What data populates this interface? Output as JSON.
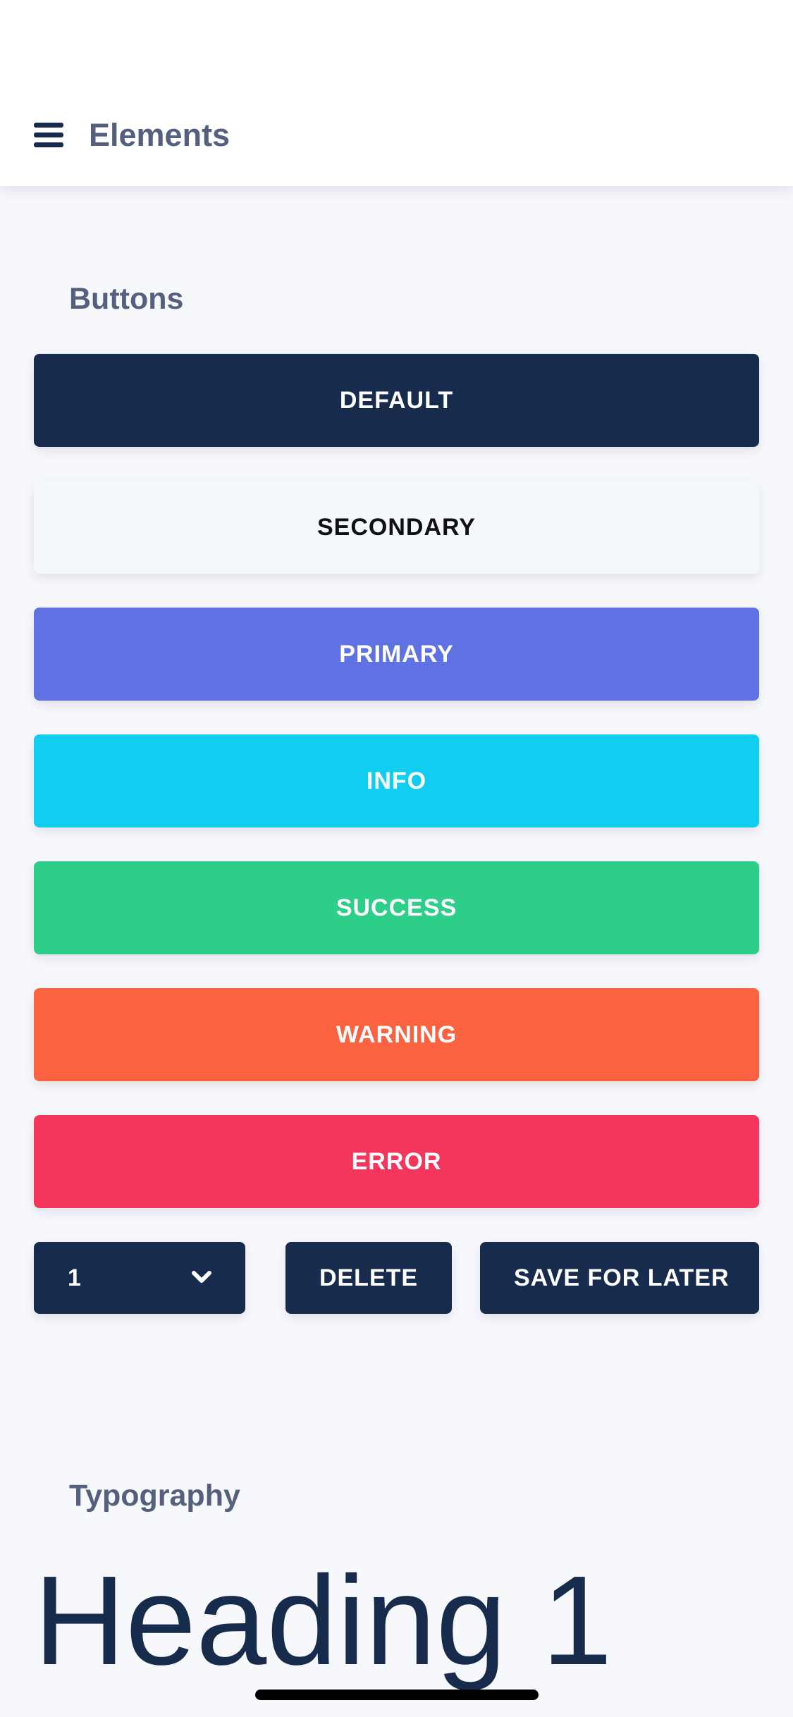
{
  "header": {
    "title": "Elements",
    "menu_icon": "hamburger-menu-icon"
  },
  "sections": {
    "buttons_title": "Buttons",
    "typography_title": "Typography"
  },
  "buttons": {
    "default": "DEFAULT",
    "secondary": "SECONDARY",
    "primary": "PRIMARY",
    "info": "INFO",
    "success": "SUCCESS",
    "warning": "WARNING",
    "error": "ERROR"
  },
  "controls": {
    "select_value": "1",
    "select_icon": "chevron-down-icon",
    "delete": "DELETE",
    "save_for_later": "SAVE FOR LATER"
  },
  "typography": {
    "heading1": "Heading 1"
  },
  "colors": {
    "default": "#172b4d",
    "secondary": "#f4f8fd",
    "primary": "#5e72e4",
    "info": "#11cdef",
    "success": "#2dce89",
    "warning": "#fb6340",
    "error": "#f5365c",
    "background": "#f7f8fc",
    "section_title": "#55607e"
  }
}
